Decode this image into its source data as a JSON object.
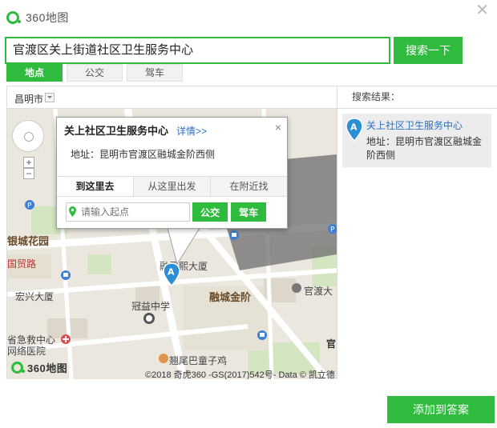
{
  "app": {
    "logo_text": "360地图",
    "close_glyph": "✕"
  },
  "search": {
    "value": "官渡区关上街道社区卫生服务中心",
    "button_label": "搜索一下"
  },
  "tabs": [
    {
      "label": "地点",
      "active": true
    },
    {
      "label": "公交",
      "active": false
    },
    {
      "label": "驾车",
      "active": false
    }
  ],
  "map": {
    "city": "昌明市",
    "place_labels": {
      "yinchengjiepan": "融城金阶",
      "hongxing": "宏兴大厦",
      "guanyi": "冠益中学",
      "emergency_1": "省急救中心",
      "emergency_2": "网络医院",
      "zhuwei": "翘尾巴童子鸡",
      "guandu": "官渡大",
      "garden": "银城花园",
      "road": "国贸路",
      "mansion": "融晋熙大厦",
      "guan": "官"
    },
    "marker_letter": "A",
    "logo_text": "360地图",
    "copyright": "©2018 奇虎360 -GS(2017)542号- Data © 凯立德"
  },
  "popup": {
    "title": "关上社区卫生服务中心",
    "detail_link": "详情>>",
    "close_glyph": "×",
    "address": "地址：昆明市官渡区融城金阶西侧",
    "tabs": [
      "到这里去",
      "从这里出发",
      "在附近找"
    ],
    "start_placeholder": "请输入起点",
    "bus_button": "公交",
    "drive_button": "驾车"
  },
  "results": {
    "title": "搜索结果：",
    "items": [
      {
        "letter": "A",
        "name": "关上社区卫生服务中心",
        "address": "地址：昆明市官渡区融城金阶西侧"
      }
    ]
  },
  "footer": {
    "add_button": "添加到答案"
  },
  "colors": {
    "accent": "#2fbb3d",
    "link": "#2a6fc0",
    "marker": "#2b8fd6"
  }
}
